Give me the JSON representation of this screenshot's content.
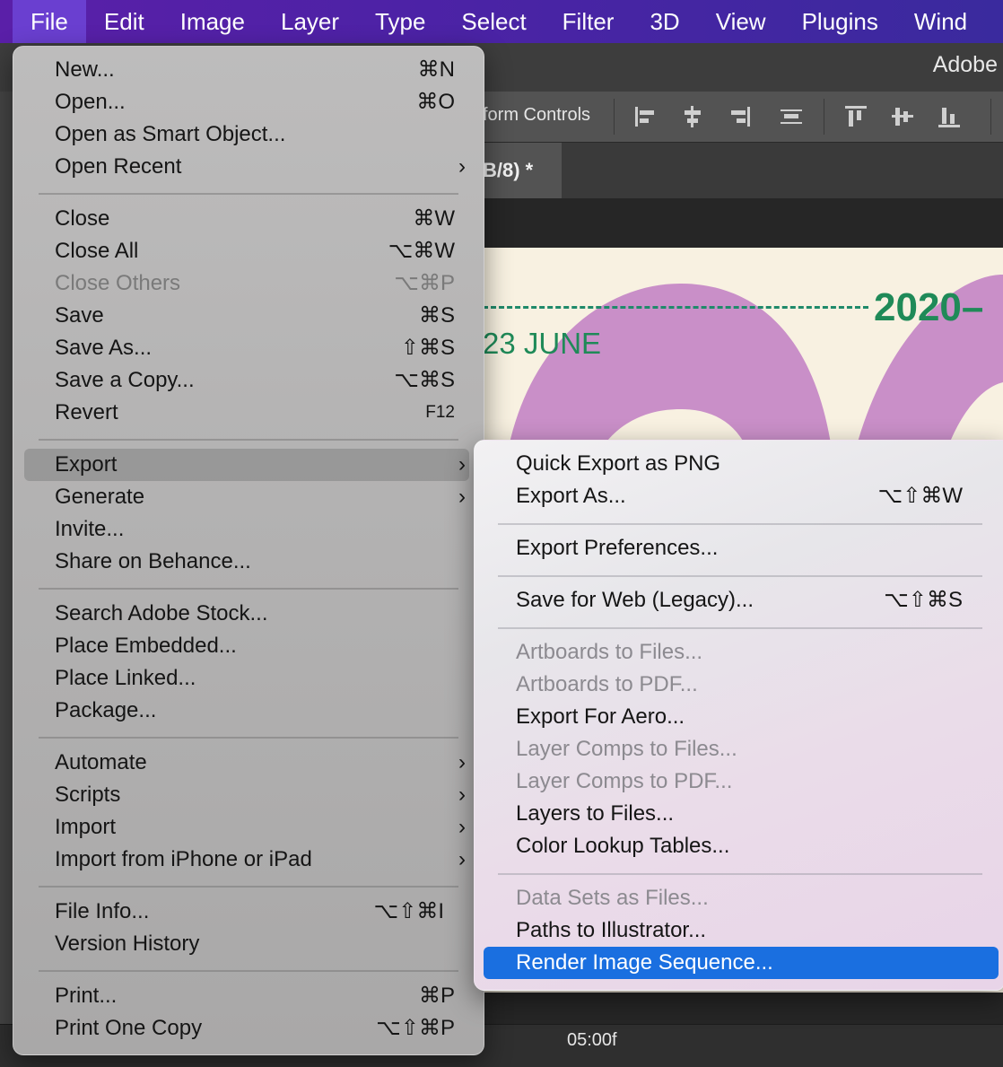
{
  "menubar": {
    "items": [
      "File",
      "Edit",
      "Image",
      "Layer",
      "Type",
      "Select",
      "Filter",
      "3D",
      "View",
      "Plugins",
      "Wind"
    ]
  },
  "app": {
    "title": "Adobe",
    "options_label": "form Controls",
    "doc_tab": "B/8) *",
    "timeline_time": "05:00f"
  },
  "canvas": {
    "year_text": "2020–",
    "date_text": "23 JUNE"
  },
  "file_menu": {
    "new": {
      "label": "New...",
      "shortcut": "⌘N"
    },
    "open": {
      "label": "Open...",
      "shortcut": "⌘O"
    },
    "open_smart": {
      "label": "Open as Smart Object..."
    },
    "open_recent": {
      "label": "Open Recent"
    },
    "close": {
      "label": "Close",
      "shortcut": "⌘W"
    },
    "close_all": {
      "label": "Close All",
      "shortcut": "⌥⌘W"
    },
    "close_others": {
      "label": "Close Others",
      "shortcut": "⌥⌘P"
    },
    "save": {
      "label": "Save",
      "shortcut": "⌘S"
    },
    "save_as": {
      "label": "Save As...",
      "shortcut": "⇧⌘S"
    },
    "save_copy": {
      "label": "Save a Copy...",
      "shortcut": "⌥⌘S"
    },
    "revert": {
      "label": "Revert",
      "shortcut": "F12"
    },
    "export": {
      "label": "Export"
    },
    "generate": {
      "label": "Generate"
    },
    "invite": {
      "label": "Invite..."
    },
    "share_behance": {
      "label": "Share on Behance..."
    },
    "search_stock": {
      "label": "Search Adobe Stock..."
    },
    "place_embedded": {
      "label": "Place Embedded..."
    },
    "place_linked": {
      "label": "Place Linked..."
    },
    "package": {
      "label": "Package..."
    },
    "automate": {
      "label": "Automate"
    },
    "scripts": {
      "label": "Scripts"
    },
    "import": {
      "label": "Import"
    },
    "import_iphone": {
      "label": "Import from iPhone or iPad"
    },
    "file_info": {
      "label": "File Info...",
      "shortcut": "⌥⇧⌘I"
    },
    "version_history": {
      "label": "Version History"
    },
    "print": {
      "label": "Print...",
      "shortcut": "⌘P"
    },
    "print_one": {
      "label": "Print One Copy",
      "shortcut": "⌥⇧⌘P"
    }
  },
  "export_menu": {
    "quick_export": {
      "label": "Quick Export as PNG"
    },
    "export_as": {
      "label": "Export As...",
      "shortcut": "⌥⇧⌘W"
    },
    "export_prefs": {
      "label": "Export Preferences..."
    },
    "save_for_web": {
      "label": "Save for Web (Legacy)...",
      "shortcut": "⌥⇧⌘S"
    },
    "artboards_files": {
      "label": "Artboards to Files..."
    },
    "artboards_pdf": {
      "label": "Artboards to PDF..."
    },
    "export_aero": {
      "label": "Export For Aero..."
    },
    "layer_comps_files": {
      "label": "Layer Comps to Files..."
    },
    "layer_comps_pdf": {
      "label": "Layer Comps to PDF..."
    },
    "layers_files": {
      "label": "Layers to Files..."
    },
    "color_lookup": {
      "label": "Color Lookup Tables..."
    },
    "data_sets": {
      "label": "Data Sets as Files..."
    },
    "paths_illustrator": {
      "label": "Paths to Illustrator..."
    },
    "render_sequence": {
      "label": "Render Image Sequence..."
    }
  },
  "colors": {
    "menubar_bg": "#4d22a6",
    "highlight_blue": "#1a6fe0",
    "canvas_bg": "#f8f1e1",
    "canvas_green": "#1f8a58",
    "canvas_purple": "#c98fc8"
  },
  "icons": {
    "submenu": "chevron-right-icon"
  }
}
